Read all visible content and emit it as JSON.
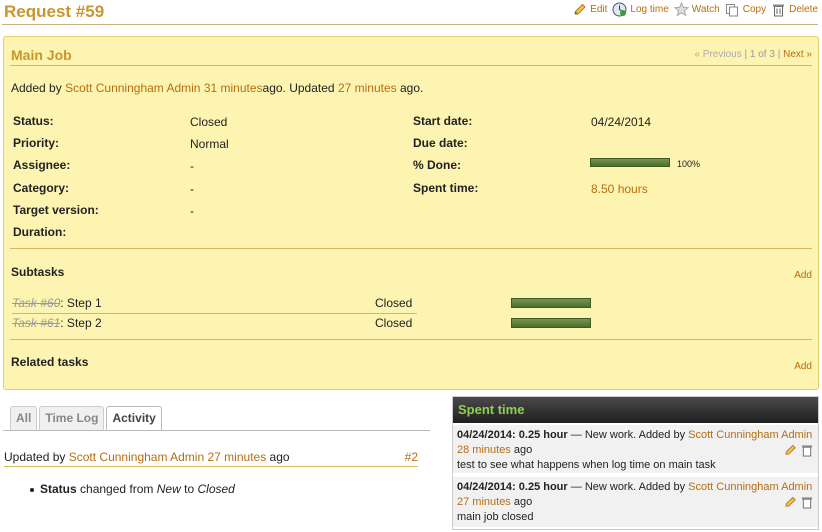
{
  "header": {
    "title": "Request #59",
    "actions": {
      "edit": "Edit",
      "log_time": "Log time",
      "watch": "Watch",
      "copy": "Copy",
      "delete": "Delete"
    }
  },
  "issue": {
    "subject": "Main Job",
    "pager": {
      "previous": "« Previous",
      "sep1": "|",
      "position": "1 of 3",
      "sep2": "|",
      "next": "Next »"
    },
    "author": {
      "added_by": "Added by",
      "user": "Scott Cunningham Admin",
      "added_ago": "31 minutes",
      "ago_updated": "ago. Updated",
      "updated_ago": "27 minutes",
      "ago_end": "ago."
    },
    "attributes": {
      "status_label": "Status:",
      "status_value": "Closed",
      "priority_label": "Priority:",
      "priority_value": "Normal",
      "assignee_label": "Assignee:",
      "assignee_value": "-",
      "category_label": "Category:",
      "category_value": "-",
      "target_version_label": "Target version:",
      "target_version_value": "-",
      "duration_label": "Duration:",
      "start_date_label": "Start date:",
      "start_date_value": "04/24/2014",
      "due_date_label": "Due date:",
      "done_label": "% Done:",
      "done_value": 100,
      "done_text": "100%",
      "spent_time_label": "Spent time:",
      "spent_time_value": "8.50 hours"
    },
    "subtasks": {
      "title": "Subtasks",
      "add": "Add",
      "rows": [
        {
          "task": "Task #60",
          "name": ": Step 1",
          "status": "Closed",
          "progress": 100
        },
        {
          "task": "Task #61",
          "name": ": Step 2",
          "status": "Closed",
          "progress": 100
        }
      ]
    },
    "related": {
      "title": "Related tasks",
      "add": "Add"
    }
  },
  "tabs": [
    "All",
    "Time Log",
    "Activity"
  ],
  "active_tab": "Activity",
  "journal": {
    "updated_by": "Updated by",
    "user": "Scott Cunningham Admin",
    "ago_value": "27 minutes",
    "ago": "ago",
    "id": "#2",
    "detail_field": "Status",
    "detail_changed": "changed from",
    "detail_old": "New",
    "detail_to": "to",
    "detail_new": "Closed"
  },
  "spent_time": {
    "title": "Spent time",
    "entries": [
      {
        "date_hours": "04/24/2014: 0.25 hour",
        "dash": "—",
        "activity": "New work. Added by",
        "user": "Scott Cunningham Admin",
        "ago_value": "28 minutes",
        "ago": "ago",
        "comment": "test to see what happens when log time on main task"
      },
      {
        "date_hours": "04/24/2014: 0.25 hour",
        "dash": "—",
        "activity": "New work. Added by",
        "user": "Scott Cunningham Admin",
        "ago_value": "27 minutes",
        "ago": "ago",
        "comment": "main job closed"
      }
    ]
  },
  "colors": {
    "accent": "#c8962e",
    "link": "#b96d10",
    "issue_bg": "#fcf4b0",
    "progress": "#5e7f3a",
    "spent_header_text": "#8fd14f"
  }
}
